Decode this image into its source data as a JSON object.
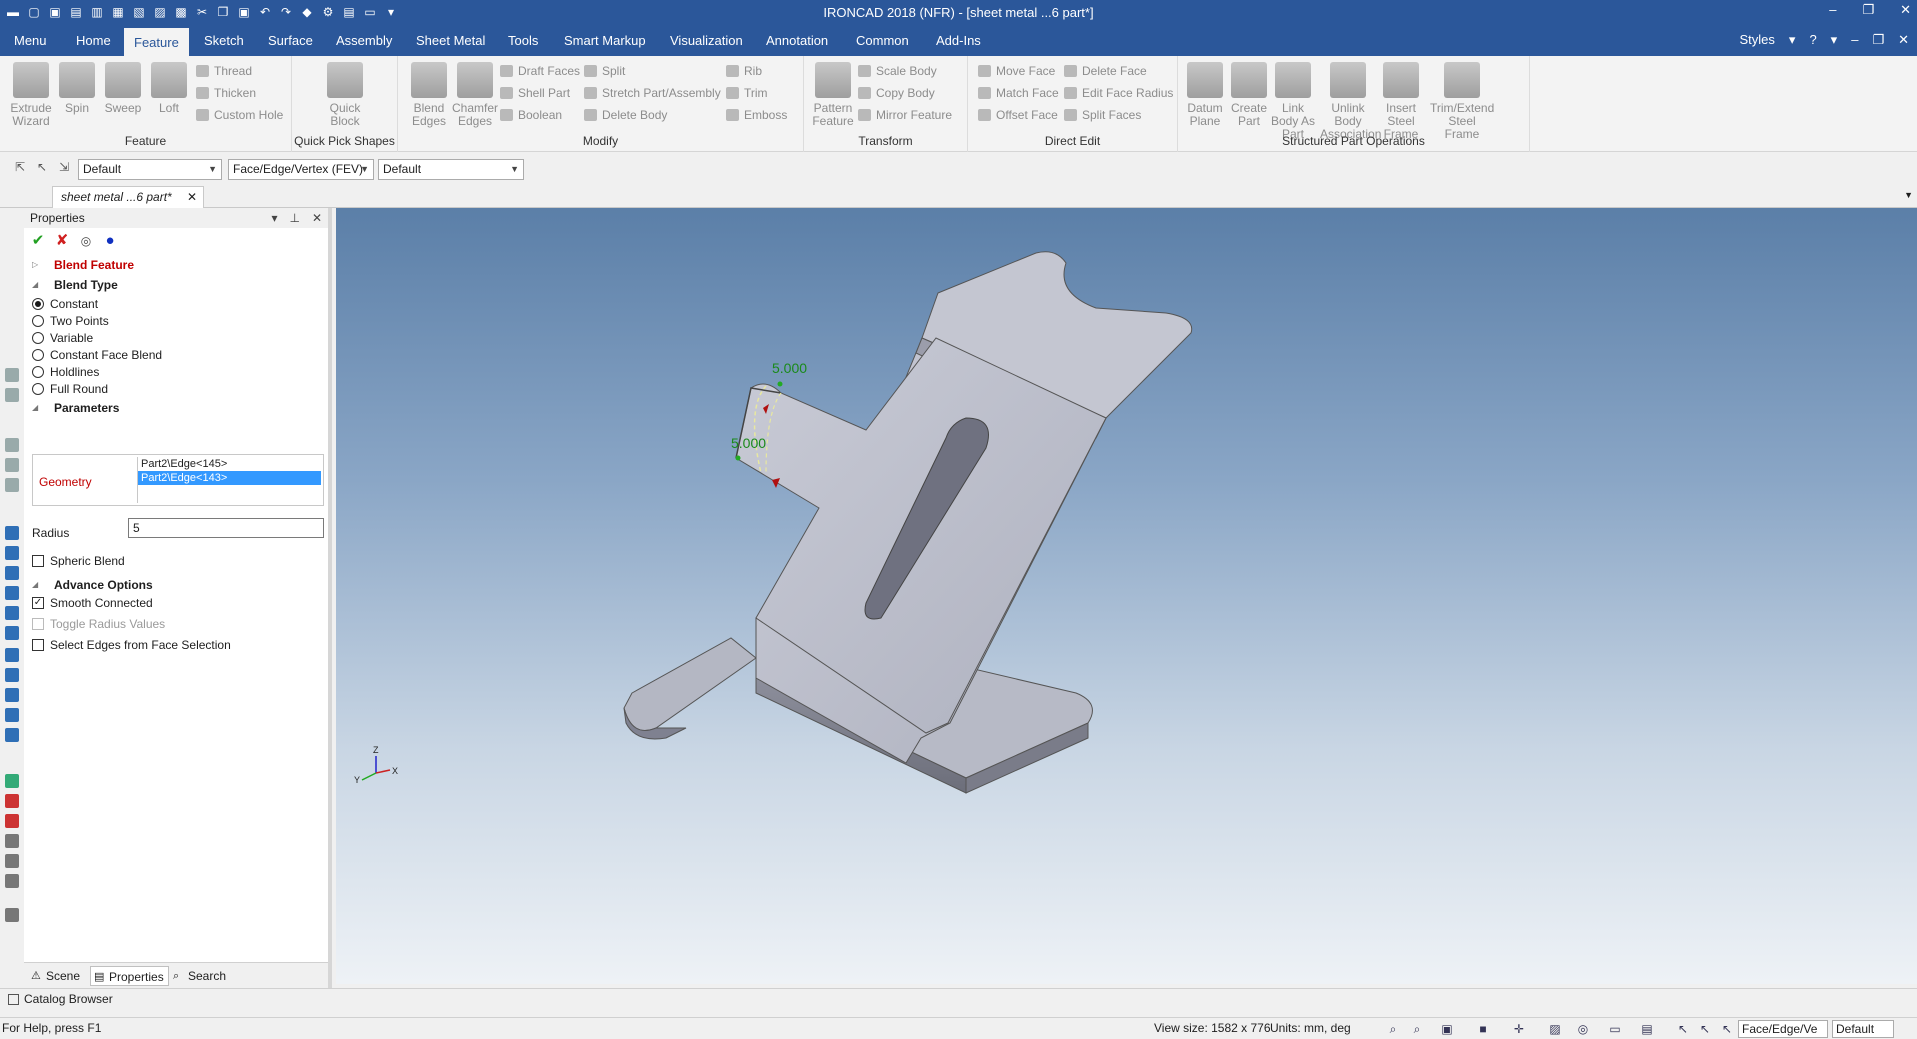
{
  "window": {
    "title": "IRONCAD 2018 (NFR) - [sheet metal ...6 part*]",
    "controls": [
      "–",
      "❐",
      "✕"
    ]
  },
  "menu": {
    "tabs": [
      "Menu",
      "Home",
      "Feature",
      "Sketch",
      "Surface",
      "Assembly",
      "Sheet Metal",
      "Tools",
      "Smart Markup",
      "Visualization",
      "Annotation",
      "Common",
      "Add-Ins"
    ],
    "active_tab": "Feature",
    "styles_label": "Styles",
    "right_icons": [
      "▾",
      "?",
      "▾",
      "–",
      "❐",
      "✕"
    ]
  },
  "ribbon": {
    "groups": {
      "feature": {
        "label": "Feature",
        "extrude": "Extrude Wizard",
        "spin": "Spin",
        "sweep": "Sweep",
        "loft": "Loft",
        "thread": "Thread",
        "thicken": "Thicken",
        "custom_hole": "Custom Hole"
      },
      "quick_pick": {
        "label": "Quick Pick Shapes",
        "quick_block": "Quick Block"
      },
      "modify": {
        "label": "Modify",
        "blend_edges": "Blend Edges",
        "chamfer_edges": "Chamfer Edges",
        "draft_faces": "Draft Faces",
        "shell_part": "Shell Part",
        "boolean": "Boolean",
        "split": "Split",
        "stretch": "Stretch Part/Assembly",
        "delete_body": "Delete Body",
        "rib": "Rib",
        "trim": "Trim",
        "emboss": "Emboss"
      },
      "transform": {
        "label": "Transform",
        "pattern": "Pattern Feature",
        "scale_body": "Scale Body",
        "copy_body": "Copy Body",
        "mirror": "Mirror Feature"
      },
      "direct_edit": {
        "label": "Direct Edit",
        "move_face": "Move Face",
        "match_face": "Match Face",
        "offset_face": "Offset Face",
        "delete_face": "Delete Face",
        "edit_face_radius": "Edit Face Radius",
        "split_faces": "Split Faces"
      },
      "structured": {
        "label": "Structured Part Operations",
        "datum_plane": "Datum Plane",
        "create_part": "Create Part",
        "link_body": "Link Body As Part",
        "unlink_body": "Unlink Body Association",
        "insert_steel": "Insert Steel Frame",
        "trim_extend": "Trim/Extend Steel Frame"
      }
    }
  },
  "filterbar": {
    "style_value": "Default",
    "selection_filter": "Face/Edge/Vertex (FEV)",
    "second_value": "Default"
  },
  "document": {
    "tab_label": "sheet metal ...6 part*",
    "close": "✕"
  },
  "properties": {
    "title": "Properties",
    "header_buttons": [
      "▾",
      "⊥",
      "✕"
    ],
    "feature_name": "Blend Feature",
    "blend_type": {
      "label": "Blend Type",
      "options": [
        "Constant",
        "Two Points",
        "Variable",
        "Constant Face Blend",
        "Holdlines",
        "Full Round"
      ],
      "selected": "Constant"
    },
    "parameters": {
      "label": "Parameters",
      "geometry_label": "Geometry",
      "geometry_items": [
        "Part2\\Edge<145>",
        "Part2\\Edge<143>"
      ],
      "selected_geometry": "Part2\\Edge<143>",
      "radius_label": "Radius",
      "radius_value": "5"
    },
    "spheric_blend": {
      "label": "Spheric Blend",
      "checked": false
    },
    "advance": {
      "label": "Advance Options",
      "smooth_connected": {
        "label": "Smooth Connected",
        "checked": true
      },
      "toggle_radius": {
        "label": "Toggle Radius Values",
        "checked": false,
        "disabled": true
      },
      "select_edges": {
        "label": "Select Edges from Face Selection",
        "checked": false
      }
    },
    "footer_tabs": [
      "Scene",
      "Properties",
      "Search"
    ],
    "active_footer_tab": "Properties"
  },
  "viewport": {
    "dim_top": "5.000",
    "dim_left": "5.000",
    "triad": {
      "x": "X",
      "y": "Y",
      "z": "Z"
    }
  },
  "catalog_browser": "Catalog Browser",
  "status": {
    "help": "For Help, press F1",
    "view_size": "View size: 1582 x 776",
    "units": "Units: mm, deg",
    "filter": "Face/Edge/Ve",
    "style": "Default"
  },
  "colors": {
    "title_blue": "#2b579a",
    "accent_red": "#c00000",
    "selection_blue": "#3399ff",
    "dim_green": "#22aa22"
  }
}
